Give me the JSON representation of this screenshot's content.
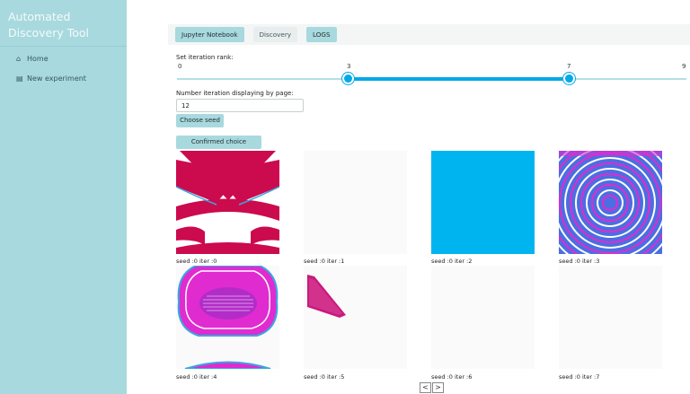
{
  "app": {
    "title": "Automated Discovery Tool"
  },
  "sidebar": {
    "items": [
      {
        "label": "Home",
        "icon": "home-icon"
      },
      {
        "label": "New experiment",
        "icon": "experiment-icon"
      }
    ]
  },
  "tabs": [
    {
      "label": "Jupyter Notebook",
      "active": true
    },
    {
      "label": "Discovery",
      "active": false
    },
    {
      "label": "LOGS",
      "active": true
    }
  ],
  "slider": {
    "label": "Set iteration rank:",
    "min": 0,
    "max": 9,
    "ticks": [
      "0",
      "3",
      "7",
      "9"
    ],
    "selected_range": [
      3,
      7
    ],
    "accent": "#04a9e8"
  },
  "page_size": {
    "label": "Number iteration displaying by page:",
    "value": "12"
  },
  "buttons": {
    "choose_seed": "Choose seed",
    "confirmed_choice": "Confirmed choice"
  },
  "gallery": [
    {
      "caption": "seed :0 iter :0",
      "image": "crimson-white-chevron-pattern"
    },
    {
      "caption": "seed :0 iter :1",
      "image": "blank"
    },
    {
      "caption": "seed :0 iter :2",
      "image": "solid-cyan"
    },
    {
      "caption": "seed :0 iter :3",
      "image": "magenta-cyan-wave-interference"
    },
    {
      "caption": "seed :0 iter :4",
      "image": "magenta-blob-rings"
    },
    {
      "caption": "seed :0 iter :5",
      "image": "small-magenta-triangle"
    },
    {
      "caption": "seed :0 iter :6",
      "image": "blank"
    },
    {
      "caption": "seed :0 iter :7",
      "image": "blank"
    }
  ],
  "pager": {
    "prev": "<",
    "next": ">"
  }
}
